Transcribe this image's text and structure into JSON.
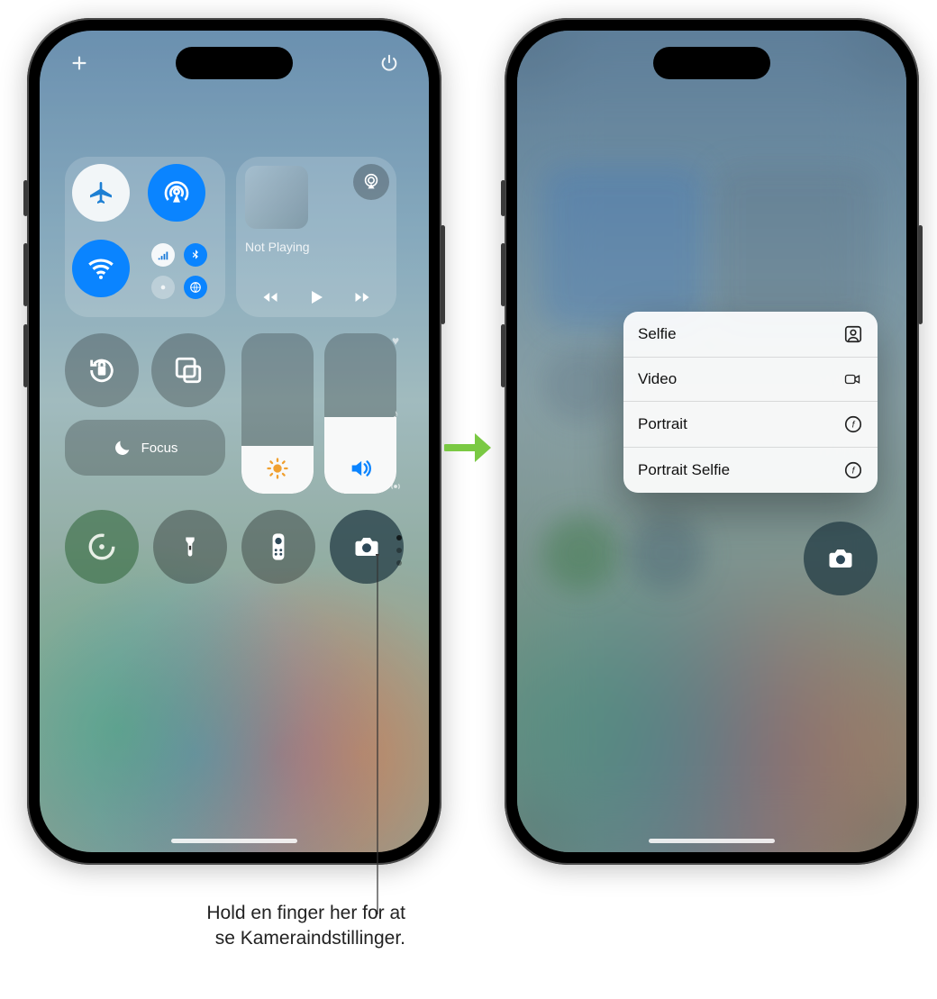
{
  "left_phone": {
    "media": {
      "status": "Not Playing"
    },
    "focus_label": "Focus",
    "brightness_pct": 30,
    "volume_pct": 48
  },
  "right_phone": {
    "menu": [
      {
        "label": "Selfie",
        "icon": "selfie-icon"
      },
      {
        "label": "Video",
        "icon": "video-icon"
      },
      {
        "label": "Portrait",
        "icon": "aperture-icon"
      },
      {
        "label": "Portrait Selfie",
        "icon": "aperture-icon"
      }
    ]
  },
  "caption": {
    "line1": "Hold en finger her for at",
    "line2": "se Kameraindstillinger."
  }
}
